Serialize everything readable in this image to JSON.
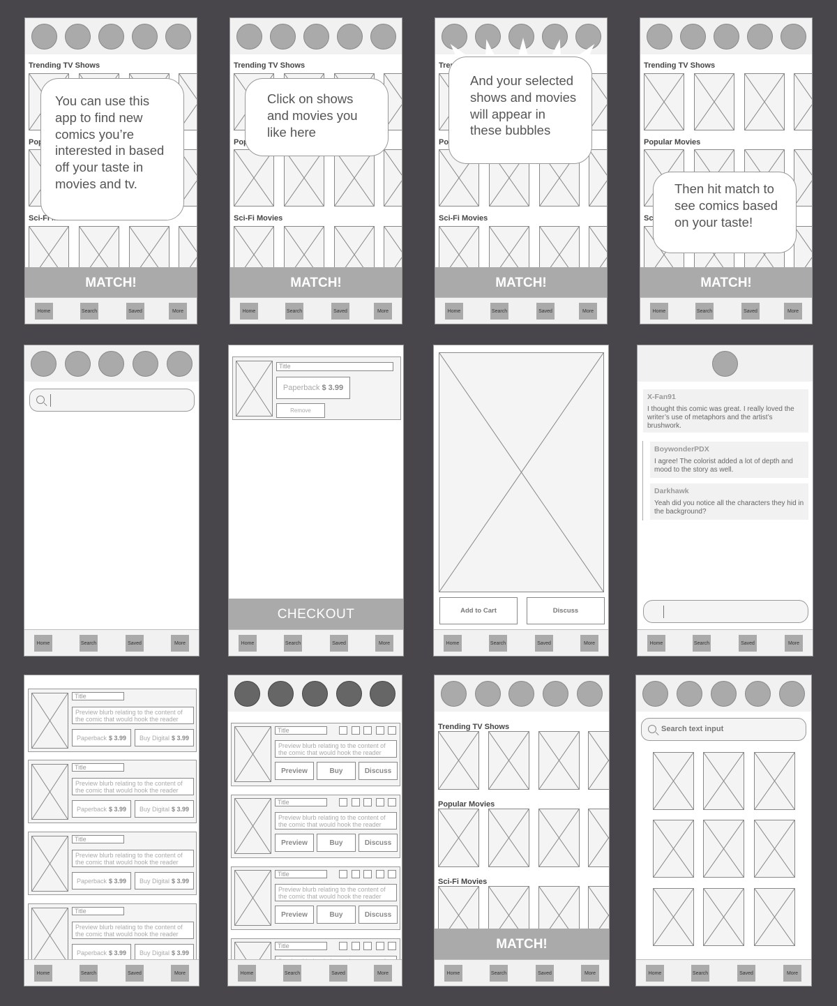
{
  "nav": [
    "Home",
    "Search",
    "Saved",
    "More"
  ],
  "sections": {
    "trending": "Trending TV Shows",
    "popular": "Popular Movies",
    "scifi": "Sci-Fi Movies"
  },
  "match_label": "MATCH!",
  "checkout_label": "CHECKOUT",
  "onboarding": [
    "You can use this app to find new comics you’re interested in based off your taste in movies and tv.",
    "Click on shows and movies you like here",
    "And your selected shows and movies will appear in these bubbles",
    "Then hit match to see comics based on your taste!"
  ],
  "cart_item": {
    "title": "Title",
    "format": "Paperback",
    "price": "$ 3.99",
    "remove": "Remove"
  },
  "detail": {
    "add_to_cart": "Add to Cart",
    "discuss": "Discuss"
  },
  "comments": [
    {
      "user": "X-Fan91",
      "text": "I thought this comic was great. I really loved the writer’s use of metaphors and the artist’s brushwork."
    },
    {
      "user": "BoywonderPDX",
      "text": "I agree! The colorist added a lot of depth and mood to the story as well."
    },
    {
      "user": "Darkhawk",
      "text": "Yeah did you notice all the characters they hid in the background?"
    }
  ],
  "list": {
    "title": "Title",
    "blurb": "Preview blurb relating to the content of the comic that would hook the reader",
    "paperback": "Paperback",
    "digital": "Buy Digital",
    "price": "$ 3.99"
  },
  "actions": {
    "preview": "Preview",
    "buy": "Buy",
    "discuss": "Discuss"
  },
  "search_placeholder": "Search text input"
}
